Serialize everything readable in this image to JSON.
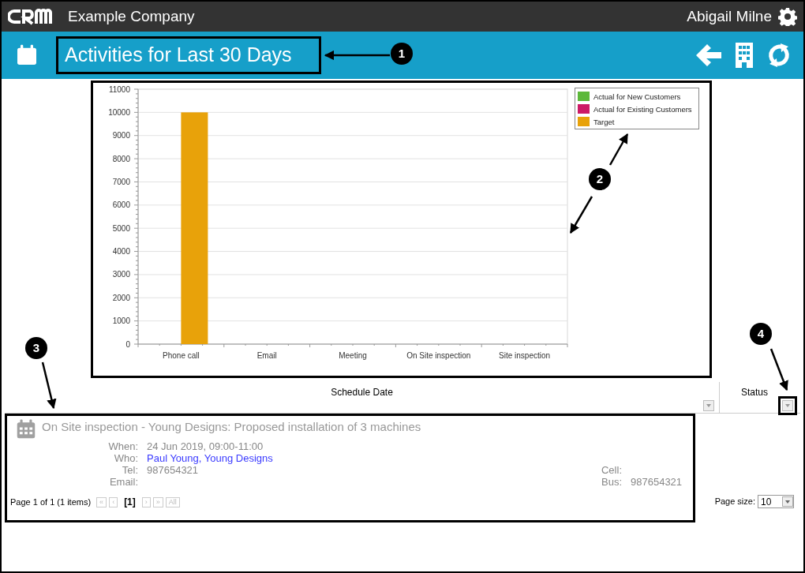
{
  "top_bar": {
    "company": "Example Company",
    "user": "Abigail Milne"
  },
  "page_header": {
    "title": "Activities for Last 30 Days"
  },
  "chart_data": {
    "type": "bar",
    "grid": true,
    "categories": [
      "Phone call",
      "Email",
      "Meeting",
      "On Site inspection",
      "Site inspection"
    ],
    "ylim": [
      0,
      11000
    ],
    "yticks": [
      0,
      1000,
      2000,
      3000,
      4000,
      5000,
      6000,
      7000,
      8000,
      9000,
      10000,
      11000
    ],
    "series": [
      {
        "name": "Actual for New Customers",
        "color": "#5cb83a",
        "values": [
          0,
          0,
          0,
          0,
          0
        ]
      },
      {
        "name": "Actual for Existing Customers",
        "color": "#cc1a66",
        "values": [
          0,
          0,
          0,
          0,
          0
        ]
      },
      {
        "name": "Target",
        "color": "#e8a20a",
        "values": [
          10000,
          0,
          0,
          0,
          0
        ]
      }
    ]
  },
  "grid": {
    "columns": [
      {
        "label": "Schedule Date"
      },
      {
        "label": "Status"
      }
    ],
    "rows": [
      {
        "title": "On Site inspection - Young Designs: Proposed installation of 3 machines",
        "fields": [
          {
            "label": "When:",
            "value": "24 Jun 2019, 09:00-11:00",
            "kind": "text"
          },
          {
            "label": "Who:",
            "value": "Paul Young, Young Designs",
            "kind": "link"
          },
          {
            "label": "Tel:",
            "value": "987654321",
            "kind": "text"
          },
          {
            "label": "Email:",
            "kind": "text"
          }
        ],
        "side_fields": [
          {
            "label": "Cell:"
          },
          {
            "label": "Bus:",
            "value": "987654321"
          }
        ]
      }
    ],
    "pager": {
      "summary": "Page 1 of 1 (1 items)",
      "buttons": [
        {
          "label": "«"
        },
        {
          "label": "‹"
        },
        {
          "label": "[1]",
          "kind": "current"
        },
        {
          "label": "›"
        },
        {
          "label": "»"
        },
        {
          "label": "All"
        }
      ],
      "page_size_label": "Page size:",
      "page_size": "10"
    }
  },
  "annotations": [
    {
      "label": "1"
    },
    {
      "label": "2"
    },
    {
      "label": "3"
    },
    {
      "label": "4"
    }
  ]
}
